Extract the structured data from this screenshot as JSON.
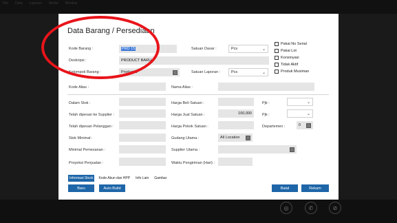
{
  "menubar": {
    "items": [
      "File",
      "Data",
      "Laporan",
      "Modul",
      "Window"
    ]
  },
  "form": {
    "title": "Data Barang / Persediaan",
    "kode_barang": {
      "label": "Kode Barang :",
      "value": "PRD 15"
    },
    "deskripsi": {
      "label": "Deskripsi :",
      "value": "PRODUCT BARU"
    },
    "kelompok_barang": {
      "label": "Kelompok Barang :",
      "value": "Product 1"
    },
    "satuan_dasar": {
      "label": "Satuan Dasar :",
      "value": "Pcs"
    },
    "satuan_laporan": {
      "label": "Satuan Laporan :",
      "value": "Pcs"
    },
    "checkboxes": [
      "Pakai No Serial",
      "Pakai Lot",
      "Konsinyasi",
      "Tidak Aktif",
      "Produk Musiman"
    ],
    "kode_alias": {
      "label": "Kode Alias :",
      "value": ""
    },
    "nama_alias": {
      "label": "Nama Alias :",
      "value": ""
    },
    "left_fields": [
      {
        "label": "Dalam Stok :",
        "value": ""
      },
      {
        "label": "Telah dipesan ke Supplier :",
        "value": ""
      },
      {
        "label": "Telah dipesan Pelanggan :",
        "value": ""
      },
      {
        "label": "Stok Minimal :",
        "value": ""
      },
      {
        "label": "Minimal Pemesanan :",
        "value": ""
      },
      {
        "label": "Proyeksi Penjualan :",
        "value": ""
      }
    ],
    "harga_beli": {
      "label": "Harga Beli Satuan :",
      "value": ""
    },
    "harga_jual": {
      "label": "Harga Jual Satuan :",
      "value": "100,000"
    },
    "harga_pokok": {
      "label": "Harga Pokok Satuan :",
      "value": ""
    },
    "gudang_utama": {
      "label": "Gudang Utama :",
      "value": "All Location"
    },
    "supplier_utama": {
      "label": "Supplier Utama :",
      "value": ""
    },
    "waktu_pengiriman": {
      "label": "Waktu Pengiriman (Hari) :",
      "value": ""
    },
    "pjk1": {
      "label": "Pjk :",
      "value": ""
    },
    "pjk2": {
      "label": "Pjk :",
      "value": ""
    },
    "departemen": {
      "label": "Departemen :",
      "value": "0"
    }
  },
  "tabs": [
    "Informasi Stock",
    "Kode Akun dan HPP",
    "Info Lain",
    "Gambar"
  ],
  "buttons": {
    "baru": "Baru",
    "auto_build": "Auto Build",
    "batal": "Batal",
    "rekam": "Rekam"
  },
  "colors": {
    "accent": "#1e66a8",
    "annotation": "#e8141a"
  }
}
